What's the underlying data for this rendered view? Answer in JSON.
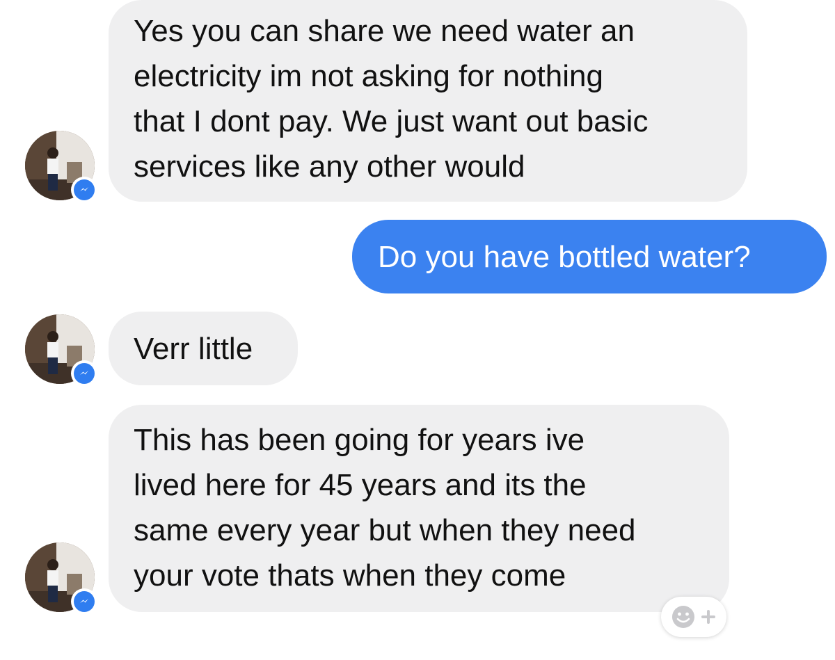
{
  "conversation": {
    "messages": [
      {
        "sender": "contact",
        "text": "Yes you can share we need water an\nelectricity im not asking for nothing\nthat I dont pay. We just want out basic\nservices like any other would"
      },
      {
        "sender": "me",
        "text": "Do you have bottled water?"
      },
      {
        "sender": "contact",
        "text": "Verr little"
      },
      {
        "sender": "contact",
        "text": "This has been going for years ive\nlived here for 45 years and its the\nsame every year but when they need\nyour vote thats when they come"
      }
    ]
  },
  "colors": {
    "incoming_bubble": "#efeff0",
    "outgoing_bubble": "#3b82f0",
    "messenger_badge": "#2f7df0"
  },
  "icons": {
    "badge": "messenger-icon",
    "reaction": "add-reaction-icon"
  }
}
